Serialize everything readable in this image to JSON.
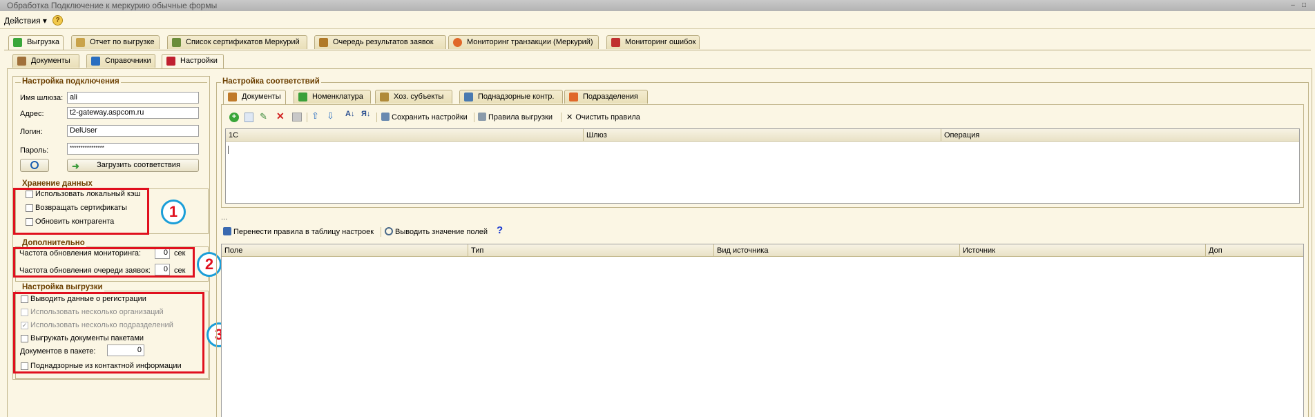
{
  "window": {
    "title": "Обработка  Подключение к меркурию обычные формы",
    "min": "–",
    "max": "□"
  },
  "menu": {
    "actions": "Действия",
    "help": "?"
  },
  "top_tabs": [
    {
      "label": "Выгрузка",
      "color": "#3aa63a"
    },
    {
      "label": "Отчет по выгрузке",
      "color": "#c9a34a"
    },
    {
      "label": "Список сертификатов Меркурий",
      "color": "#6a8c3a"
    },
    {
      "label": "Очередь результатов заявок",
      "color": "#b07a2a"
    },
    {
      "label": "Мониторинг транзакции (Меркурий)",
      "color": "#e0682a"
    },
    {
      "label": "Мониторинг ошибок",
      "color": "#c03030"
    }
  ],
  "sub_tabs": [
    {
      "label": "Документы",
      "color": "#a0703a"
    },
    {
      "label": "Справочники",
      "color": "#2a6ec0"
    },
    {
      "label": "Настройки",
      "color": "#c02030"
    }
  ],
  "connection": {
    "title": "Настройка подключения",
    "gateway_label": "Имя шлюза:",
    "gateway_value": "ali",
    "address_label": "Адрес:",
    "address_value": "t2-gateway.aspcom.ru",
    "login_label": "Логин:",
    "login_value": "DelUser",
    "password_label": "Пароль:",
    "password_value": "****************",
    "load_button": "Загрузить соответствия"
  },
  "storage": {
    "title": "Хранение данных",
    "items": [
      "Использовать локальный кэш",
      "Возвращать сертификаты",
      "Обновить контрагента"
    ]
  },
  "additional": {
    "title": "Дополнительно",
    "monitor_label": "Частота обновления мониторинга:",
    "monitor_value": "0",
    "monitor_unit": "сек",
    "queue_label": "Частота обновления очереди заявок:",
    "queue_value": "0",
    "queue_unit": "сек"
  },
  "export": {
    "title": "Настройка выгрузки",
    "items": [
      {
        "label": "Выводить данные о регистрации",
        "disabled": false,
        "checked": false
      },
      {
        "label": "Использовать несколько организаций",
        "disabled": true,
        "checked": false
      },
      {
        "label": "Использовать несколько подразделений",
        "disabled": true,
        "checked": true
      },
      {
        "label": "Выгружать документы пакетами",
        "disabled": false,
        "checked": false
      }
    ],
    "docs_label": "Документов в пакете:",
    "docs_value": "0",
    "last_item": "Поднадзорные из контактной информации"
  },
  "annotations": [
    "1",
    "2",
    "3"
  ],
  "mapping": {
    "title": "Настройка соответствий",
    "tabs": [
      {
        "label": "Документы",
        "color": "#c07a2a"
      },
      {
        "label": "Номенклатура",
        "color": "#3aa03a"
      },
      {
        "label": "Хоз. субъекты",
        "color": "#b08a3a"
      },
      {
        "label": "Поднадзорные контр.",
        "color": "#4a7ab0"
      },
      {
        "label": "Подразделения",
        "color": "#e0682a"
      }
    ],
    "toolbar": {
      "save": "Сохранить настройки",
      "rules": "Правила выгрузки",
      "clear": "Очистить правила"
    },
    "grid1_cols": [
      "1С",
      "Шлюз",
      "Операция"
    ],
    "ellipsis": "...",
    "toolbar2": {
      "move": "Перенести правила в таблицу настроек",
      "show": "Выводить значение полей",
      "help": "?"
    },
    "grid2_cols": [
      "Поле",
      "Тип",
      "Вид источника",
      "Источник",
      "Доп"
    ]
  }
}
